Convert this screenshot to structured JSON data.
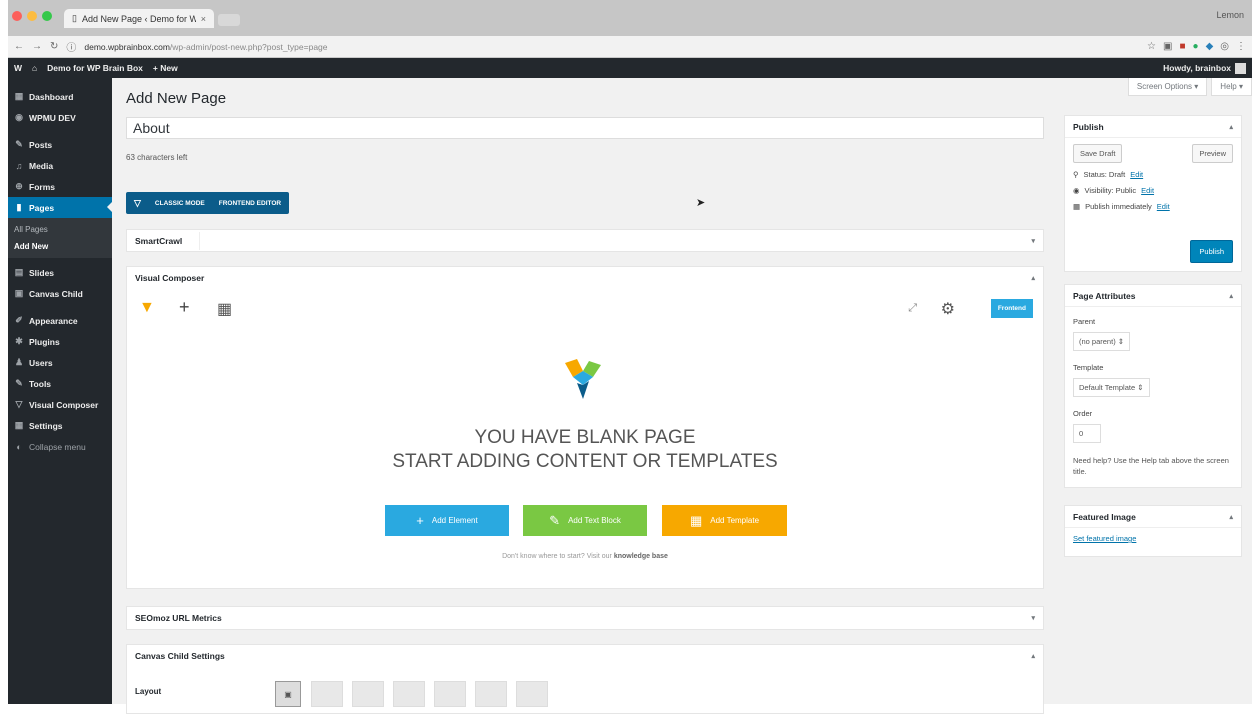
{
  "browser": {
    "tab_title": "Add New Page ‹ Demo for WP",
    "tab_close": "×",
    "profile": "Lemon",
    "url_host": "demo.wpbrainbox.com",
    "url_path": "/wp-admin/post-new.php?post_type=page",
    "icons": [
      "back-icon",
      "forward-icon",
      "reload-icon",
      "info-icon"
    ]
  },
  "adminbar": {
    "wp_logo": "W",
    "site_name": "Demo for WP Brain Box",
    "new_label": "+ New",
    "howdy": "Howdy, brainbox"
  },
  "sidebar": {
    "items": [
      {
        "label": "Dashboard",
        "icon": "▦"
      },
      {
        "label": "WPMU DEV",
        "icon": "◉"
      },
      {
        "label": "Posts",
        "icon": "✎"
      },
      {
        "label": "Media",
        "icon": "♫"
      },
      {
        "label": "Forms",
        "icon": "⊕"
      },
      {
        "label": "Pages",
        "icon": "▮"
      },
      {
        "label": "Slides",
        "icon": "▤"
      },
      {
        "label": "Canvas Child",
        "icon": "▣"
      },
      {
        "label": "Appearance",
        "icon": "✐"
      },
      {
        "label": "Plugins",
        "icon": "✱"
      },
      {
        "label": "Users",
        "icon": "♟"
      },
      {
        "label": "Tools",
        "icon": "✎"
      },
      {
        "label": "Visual Composer",
        "icon": "▽"
      },
      {
        "label": "Settings",
        "icon": "▦"
      },
      {
        "label": "Collapse menu",
        "icon": "◐"
      }
    ],
    "pages_sub": [
      "All Pages",
      "Add New"
    ]
  },
  "header": {
    "screen_options": "Screen Options ▾",
    "help": "Help ▾",
    "page_title": "Add New Page"
  },
  "editor": {
    "title_value": "About",
    "char_count": "63 characters left",
    "classic_mode": "CLASSIC MODE",
    "frontend_editor": "FRONTEND EDITOR"
  },
  "boxes": {
    "smartcrawl": "SmartCrawl",
    "visual_composer": "Visual Composer",
    "seomoz": "SEOmoz URL Metrics",
    "canvas_settings": "Canvas Child Settings",
    "layout_label": "Layout"
  },
  "vc": {
    "frontend_btn": "Frontend",
    "blank_line1": "YOU HAVE BLANK PAGE",
    "blank_line2": "START ADDING CONTENT OR TEMPLATES",
    "add_element": "Add Element",
    "add_text_block": "Add Text Block",
    "add_template": "Add Template",
    "kb_prefix": "Don't know where to start? Visit our ",
    "kb_link": "knowledge base",
    "colors": {
      "blue": "#2aa9e0",
      "green": "#7ac843",
      "orange": "#f7a800"
    }
  },
  "publish": {
    "heading": "Publish",
    "save_draft": "Save Draft",
    "preview": "Preview",
    "status_label": "Status: Draft",
    "visibility_label": "Visibility: Public",
    "publish_label": "Publish immediately",
    "edit": "Edit",
    "publish_btn": "Publish"
  },
  "page_attributes": {
    "heading": "Page Attributes",
    "parent_label": "Parent",
    "parent_value": "(no parent)  ⇕",
    "template_label": "Template",
    "template_value": "Default Template ⇕",
    "order_label": "Order",
    "order_value": "0",
    "help": "Need help? Use the Help tab above the screen title."
  },
  "featured": {
    "heading": "Featured Image",
    "link": "Set featured image"
  }
}
